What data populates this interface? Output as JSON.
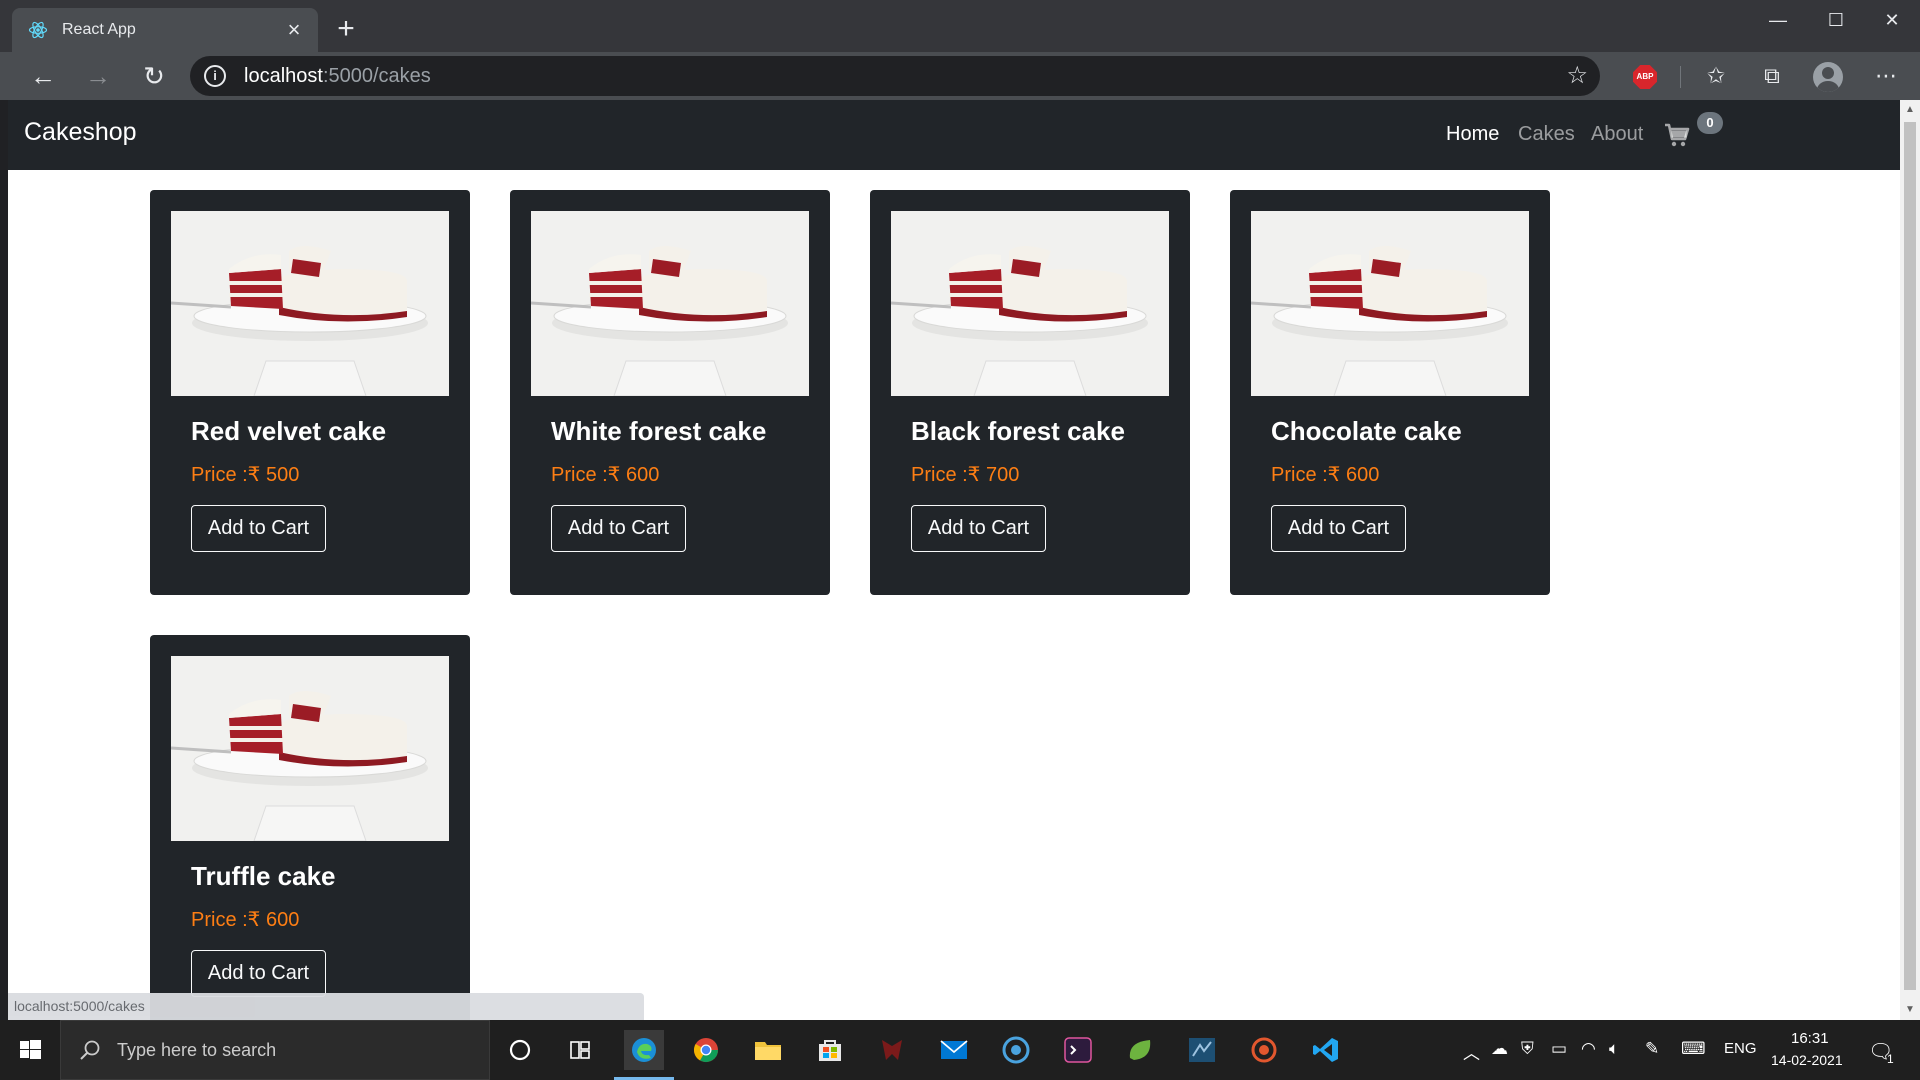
{
  "browser": {
    "tab_title": "React App",
    "url_host": "localhost",
    "url_path": ":5000/cakes",
    "abp_label": "ABP",
    "status_url": "localhost:5000/cakes"
  },
  "navbar": {
    "brand": "Cakeshop",
    "links": [
      "Home",
      "Cakes",
      "About"
    ],
    "active_link": "Home",
    "cart_count": "0"
  },
  "cakes": [
    {
      "name": "Red velvet cake",
      "price": "Price :₹ 500",
      "button": "Add to Cart"
    },
    {
      "name": "White forest cake",
      "price": "Price :₹ 600",
      "button": "Add to Cart"
    },
    {
      "name": "Black forest cake",
      "price": "Price :₹ 700",
      "button": "Add to Cart"
    },
    {
      "name": "Chocolate cake",
      "price": "Price :₹ 600",
      "button": "Add to Cart"
    },
    {
      "name": "Truffle cake",
      "price": "Price :₹ 600",
      "button": "Add to Cart"
    }
  ],
  "taskbar": {
    "search_placeholder": "Type here to search",
    "language": "ENG",
    "time": "16:31",
    "date": "14-02-2021",
    "notification_count": "1"
  },
  "colors": {
    "navbar_bg": "#212529",
    "card_bg": "#212529",
    "price_accent": "#fd7e14",
    "cart_badge": "#6c757d"
  }
}
